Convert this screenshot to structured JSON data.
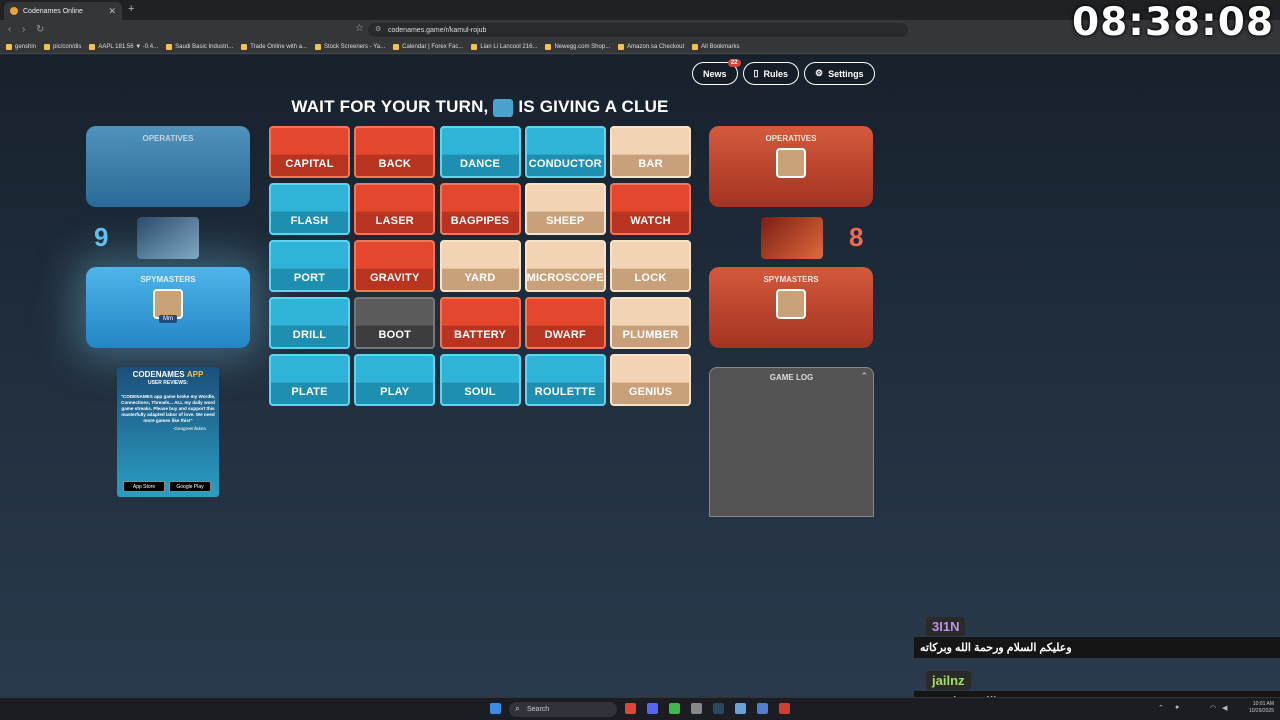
{
  "browser": {
    "tab_title": "Codenames Online",
    "url": "codenames.game/r/kamul-rojub",
    "bookmarks": [
      "genshin",
      "pic/con/dis",
      "AAPL 181.56 ▼ -0.4...",
      "Saudi Basic Industri...",
      "Trade Online with a...",
      "Stock Screeners - Ya...",
      "Calendar | Forex Fac...",
      "Lian Li Lancool 216...",
      "Newegg.com Shop...",
      "Amazon.sa Checkout",
      "All Bookmarks"
    ]
  },
  "overlay_clock": "08:38:08",
  "topbar": {
    "news": "News",
    "news_badge": "22",
    "rules": "Rules",
    "settings": "Settings"
  },
  "headline": {
    "part1": "WAIT FOR YOUR TURN,",
    "part2": "IS GIVING A CLUE"
  },
  "blue_team": {
    "operatives_title": "OPERATIVES",
    "spymasters_title": "SPYMASTERS",
    "spymaster_name": "Mm",
    "score": "9",
    "color": "#2fb3d6"
  },
  "red_team": {
    "operatives_title": "OPERATIVES",
    "spymasters_title": "SPYMASTERS",
    "score": "8",
    "color": "#e3472e"
  },
  "board": [
    {
      "word": "CAPITAL",
      "type": "red"
    },
    {
      "word": "BACK",
      "type": "red"
    },
    {
      "word": "DANCE",
      "type": "blue"
    },
    {
      "word": "CONDUCTOR",
      "type": "blue"
    },
    {
      "word": "BAR",
      "type": "neutral"
    },
    {
      "word": "FLASH",
      "type": "blue"
    },
    {
      "word": "LASER",
      "type": "red"
    },
    {
      "word": "BAGPIPES",
      "type": "red"
    },
    {
      "word": "SHEEP",
      "type": "neutral"
    },
    {
      "word": "WATCH",
      "type": "red"
    },
    {
      "word": "PORT",
      "type": "blue"
    },
    {
      "word": "GRAVITY",
      "type": "red"
    },
    {
      "word": "YARD",
      "type": "neutral"
    },
    {
      "word": "MICROSCOPE",
      "type": "neutral"
    },
    {
      "word": "LOCK",
      "type": "neutral"
    },
    {
      "word": "DRILL",
      "type": "blue"
    },
    {
      "word": "BOOT",
      "type": "assassin"
    },
    {
      "word": "BATTERY",
      "type": "red"
    },
    {
      "word": "DWARF",
      "type": "red"
    },
    {
      "word": "PLUMBER",
      "type": "neutral"
    },
    {
      "word": "PLATE",
      "type": "blue"
    },
    {
      "word": "PLAY",
      "type": "blue"
    },
    {
      "word": "SOUL",
      "type": "blue"
    },
    {
      "word": "ROULETTE",
      "type": "blue"
    },
    {
      "word": "GENIUS",
      "type": "neutral"
    }
  ],
  "ad": {
    "title_a": "CODENAMES",
    "title_b": "APP",
    "subtitle": "USER REVIEWS:",
    "quote": "\"CODENAMES app game broke my Wordle, Connections, Threads... ALL my daily word game streaks. Please buy and support this masterfully adapted labor of love. We need more games like this!\"",
    "author": "-Geogreenfaken",
    "store1": "App Store",
    "store2": "Google Play"
  },
  "game_log": {
    "title": "GAME LOG"
  },
  "chat": [
    {
      "user": "3I1N",
      "message": "وعليكم السلام ورحمة الله وبركاته"
    },
    {
      "user": "jailnz",
      "message": "والله معضله صعبه"
    }
  ],
  "taskbar": {
    "search": "Search",
    "time": "10:01 AM",
    "date": "10/29/2025"
  }
}
